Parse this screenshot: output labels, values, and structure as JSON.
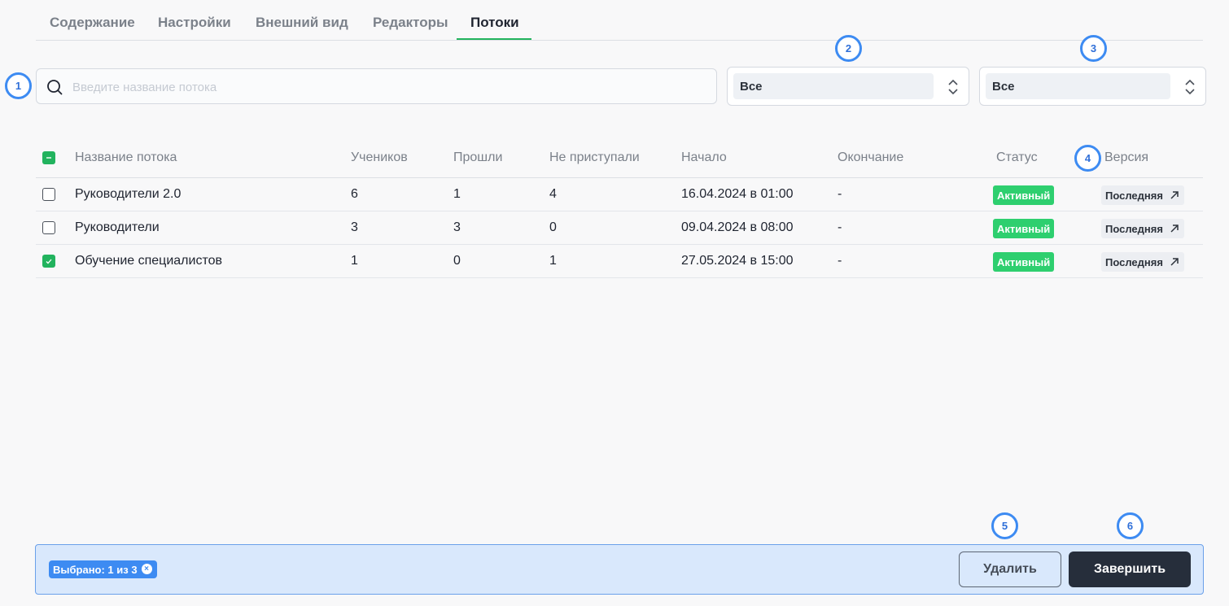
{
  "tabs": [
    {
      "label": "Содержание"
    },
    {
      "label": "Настройки"
    },
    {
      "label": "Внешний вид"
    },
    {
      "label": "Редакторы"
    },
    {
      "label": "Потоки"
    }
  ],
  "active_tab": "Потоки",
  "search": {
    "placeholder": "Введите название потока",
    "value": ""
  },
  "filters": [
    {
      "value": "Все"
    },
    {
      "value": "Все"
    }
  ],
  "markers": [
    "1",
    "2",
    "3",
    "4",
    "5",
    "6"
  ],
  "table": {
    "headers": {
      "name": "Название потока",
      "students": "Учеников",
      "passed": "Прошли",
      "not_started": "Не приступали",
      "start": "Начало",
      "end": "Окончание",
      "status": "Статус",
      "version": "Версия"
    },
    "rows": [
      {
        "name": "Руководители 2.0",
        "students": "6",
        "passed": "1",
        "not_started": "4",
        "start": "16.04.2024 в 01:00",
        "end": "-",
        "status": "Активный",
        "version": "Последняя",
        "checked": false
      },
      {
        "name": "Руководители",
        "students": "3",
        "passed": "3",
        "not_started": "0",
        "start": "09.04.2024 в 08:00",
        "end": "-",
        "status": "Активный",
        "version": "Последняя",
        "checked": false
      },
      {
        "name": "Обучение специалистов",
        "students": "1",
        "passed": "0",
        "not_started": "1",
        "start": "27.05.2024 в 15:00",
        "end": "-",
        "status": "Активный",
        "version": "Последняя",
        "checked": true
      }
    ]
  },
  "bottom_bar": {
    "selected_label": "Выбрано: 1 из 3",
    "delete_label": "Удалить",
    "finish_label": "Завершить"
  },
  "colors": {
    "accent_green": "#22b35e",
    "status_active": "#2ecf6f",
    "marker_blue": "#3d8bf2",
    "dark_button": "#262e3b"
  }
}
